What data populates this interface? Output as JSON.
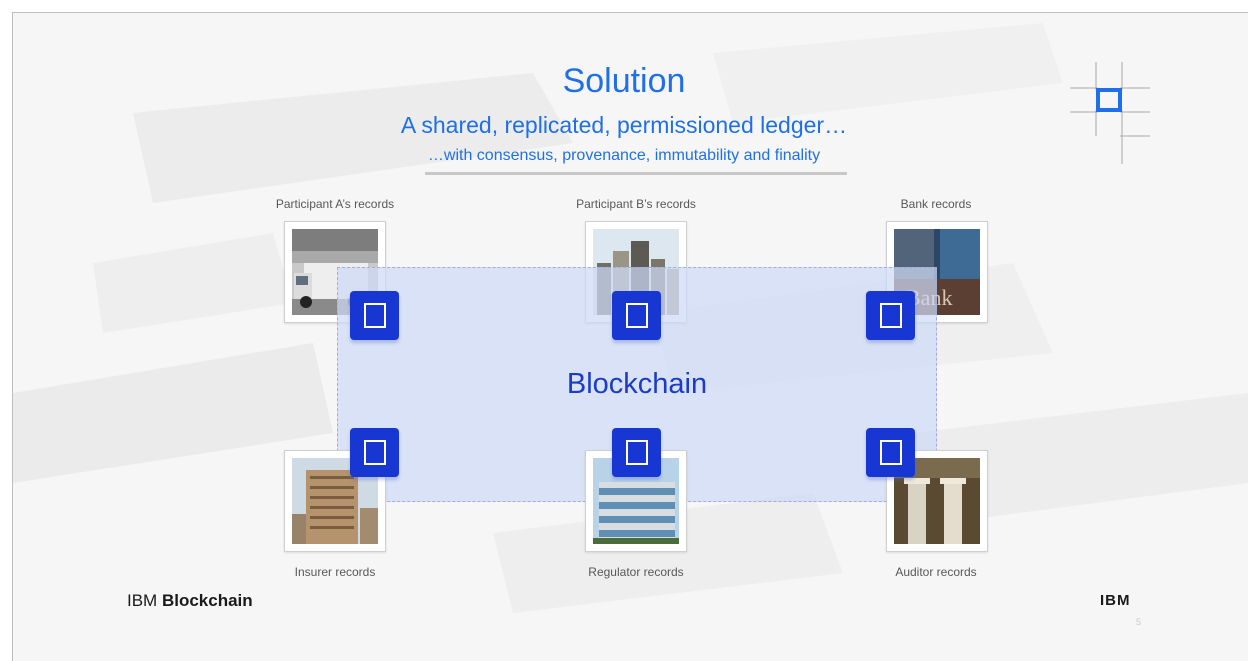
{
  "slide": {
    "title": "Solution",
    "subtitle": "A shared, replicated, permissioned ledger…",
    "subtitle2": "…with consensus, provenance, immutability and finality",
    "blockchain_label": "Blockchain",
    "page_number": "5"
  },
  "participants": {
    "participant_a": "Participant A’s records",
    "participant_b": "Participant B’s records",
    "bank": "Bank records",
    "insurer": "Insurer records",
    "regulator": "Regulator records",
    "auditor": "Auditor records"
  },
  "photo_signs": {
    "bank": "Bank"
  },
  "footer": {
    "brand_prefix": "IBM",
    "brand_name": "Blockchain",
    "logo": "IBM"
  },
  "colors": {
    "title_blue": "#1f70e8",
    "node_blue": "#1736d2",
    "blockchain_text": "#1a3cc7",
    "ledger_fill": "#cdd9f5"
  },
  "icons": {
    "ledger_node": "square-node-icon",
    "brand_mark": "blockchain-logo-icon"
  }
}
